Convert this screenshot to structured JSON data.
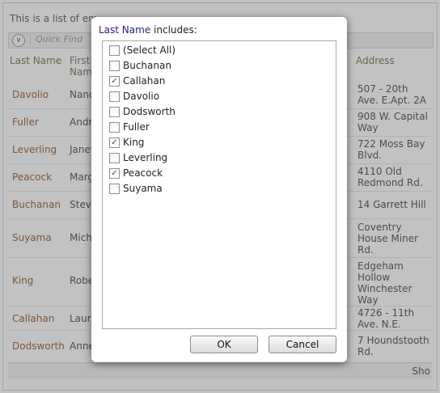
{
  "grid": {
    "description": "This is a list of em",
    "quick_find_placeholder": "Quick Find",
    "columns": {
      "last_name": "Last Name",
      "first_name": "First Name",
      "address": "Address"
    },
    "rows": [
      {
        "last": "Davolio",
        "first": "Nancy",
        "address": "507 - 20th Ave. E.Apt. 2A"
      },
      {
        "last": "Fuller",
        "first": "Andrew",
        "address": "908 W. Capital Way"
      },
      {
        "last": "Leverling",
        "first": "Janet",
        "address": "722 Moss Bay Blvd."
      },
      {
        "last": "Peacock",
        "first": "Margaret",
        "address": "4110 Old Redmond Rd."
      },
      {
        "last": "Buchanan",
        "first": "Steven",
        "address": "14 Garrett Hill"
      },
      {
        "last": "Suyama",
        "first": "Michael",
        "address": "Coventry House Miner Rd."
      },
      {
        "last": "King",
        "first": "Robert",
        "address": "Edgeham Hollow Winchester Way"
      },
      {
        "last": "Callahan",
        "first": "Laura",
        "address": "4726 - 11th Ave. N.E."
      },
      {
        "last": "Dodsworth",
        "first": "Anne",
        "address": "7 Houndstooth Rd."
      }
    ],
    "footer_text": "Sho"
  },
  "dialog": {
    "field_name": "Last Name",
    "title_suffix": " includes:",
    "options": [
      {
        "label": "(Select All)",
        "checked": false
      },
      {
        "label": "Buchanan",
        "checked": false
      },
      {
        "label": "Callahan",
        "checked": true
      },
      {
        "label": "Davolio",
        "checked": false
      },
      {
        "label": "Dodsworth",
        "checked": false
      },
      {
        "label": "Fuller",
        "checked": false
      },
      {
        "label": "King",
        "checked": true
      },
      {
        "label": "Leverling",
        "checked": false
      },
      {
        "label": "Peacock",
        "checked": true
      },
      {
        "label": "Suyama",
        "checked": false
      }
    ],
    "ok_label": "OK",
    "cancel_label": "Cancel"
  },
  "icons": {
    "expand": "chevron-down-icon",
    "checkmark": "checkmark-icon"
  },
  "colors": {
    "last_name_text": "#8b4513",
    "dialog_field": "#1f1f8f",
    "checkmark": "#2b4a8b"
  }
}
